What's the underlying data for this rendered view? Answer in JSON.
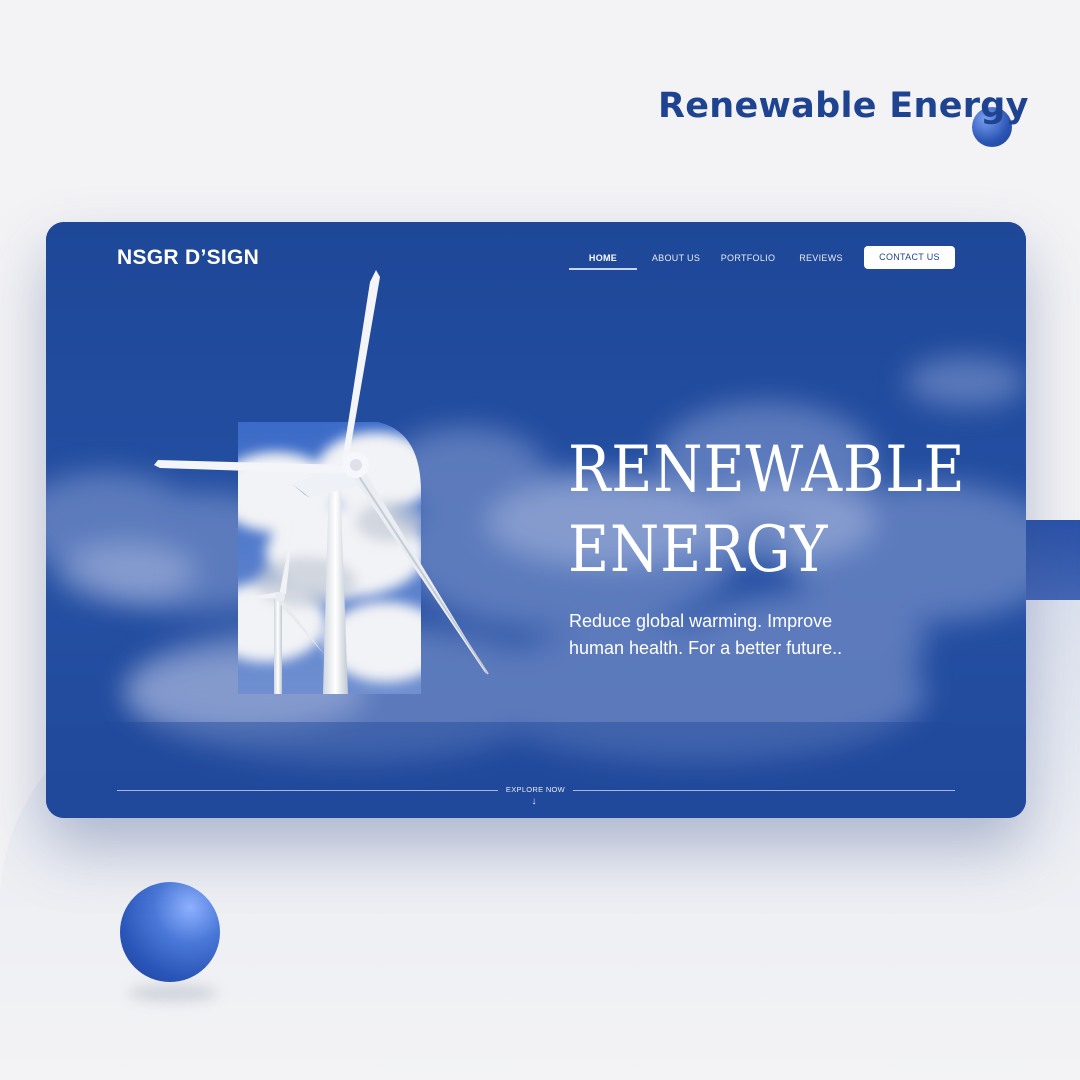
{
  "poster": {
    "title": "Renewable Energy"
  },
  "site": {
    "logo": "NSGR D’SIGN",
    "nav": [
      {
        "label": "HOME",
        "active": true
      },
      {
        "label": "ABOUT US",
        "active": false
      },
      {
        "label": "PORTFOLIO",
        "active": false
      },
      {
        "label": "REVIEWS",
        "active": false
      }
    ],
    "contact_label": "CONTACT US"
  },
  "hero": {
    "title_line1": "RENEWABLE",
    "title_line2": "ENERGY",
    "subtitle_line1": "Reduce global warming. Improve",
    "subtitle_line2": "human health. For a better future..",
    "explore_label": "EXPLORE NOW",
    "explore_arrow": "↓"
  },
  "colors": {
    "brand_blue": "#1e4390",
    "card_blue": "#1f4899",
    "accent_light": "#c9d6f2"
  },
  "icons": {
    "explore": "arrow-down-icon",
    "turbine": "wind-turbine-image"
  }
}
